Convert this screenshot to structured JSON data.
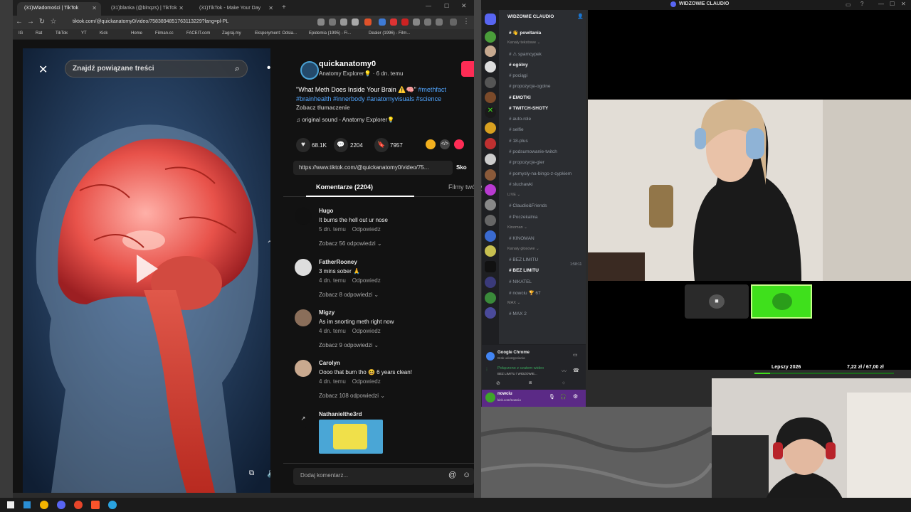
{
  "browser": {
    "tabs": [
      {
        "label": "(31)Wiadomości | TikTok",
        "active": true
      },
      {
        "label": "(31)blanka (@blnqzs) | TikTok",
        "active": false
      },
      {
        "label": "(31)TikTok - Make Your Day",
        "active": false
      }
    ],
    "url": "tiktok.com/@quickanatomy0/video/7583894851763113229?lang=pl-PL",
    "bookmarks": [
      "IG",
      "Rat",
      "TikTok",
      "YT",
      "Kick",
      "Home",
      "Filman.cc",
      "FACEIT.com",
      "Zagraj.my",
      "Eksperyment: Odsia...",
      "Epidemia (1995) - Fi...",
      "Dealer (1996) - Film..."
    ]
  },
  "video": {
    "search_placeholder": "Znajdź powiązane treści"
  },
  "post": {
    "author": "quickanatomy0",
    "subtitle": "Anatomy Explorer💡 · 6 dn. temu",
    "caption": "\"What Meth Does Inside Your Brain ⚠️🧠\" ",
    "hashtags_line1": "#methfact",
    "hashtags_line2": "#brainhealth #innerbody #anatomyvisuals #science",
    "translate": "Zobacz tłumaczenie",
    "sound": "original sound - Anatomy Explorer💡",
    "likes": "68.1K",
    "comments_count": "2204",
    "saves": "7957",
    "share_url": "https://www.tiktok.com/@quickanatomy0/video/75...",
    "copy_label": "Sko",
    "tab_comments": "Komentarze (2204)",
    "tab_creator": "Filmy twórcy",
    "add_comment_placeholder": "Dodaj komentarz..."
  },
  "comments": [
    {
      "name": "Hugo",
      "text": "It burns the hell out ur nose",
      "age": "5 dn. temu",
      "reply": "Odpowiedz",
      "more": "Zobacz 56 odpowiedzi ⌄"
    },
    {
      "name": "FatherRooney",
      "text": "3 mins sober 🙏",
      "age": "4 dn. temu",
      "reply": "Odpowiedz",
      "more": "Zobacz 8 odpowiedzi ⌄"
    },
    {
      "name": "Migzy",
      "text": "As im snorting meth right now",
      "age": "4 dn. temu",
      "reply": "Odpowiedz",
      "more": "Zobacz 9 odpowiedzi ⌄"
    },
    {
      "name": "Carolyn",
      "text": "Oooo that burn tho 😆 6 years clean!",
      "age": "4 dn. temu",
      "reply": "Odpowiedz",
      "more": "Zobacz 108 odpowiedzi ⌄"
    },
    {
      "name": "Nathanielthe3rd",
      "text": "",
      "age": "",
      "reply": "",
      "more": ""
    }
  ],
  "discord": {
    "server_name": "WIDZOWIE CLAUDIO",
    "channels": [
      {
        "label": "👋 powitania",
        "hl": true,
        "kind": "cat-item"
      },
      {
        "label": "Kanały tekstowe ⌄",
        "kind": "cat"
      },
      {
        "label": "⚠ spamcypek"
      },
      {
        "label": "ogólny",
        "hl": true
      },
      {
        "label": "pociągi"
      },
      {
        "label": "propozycje-ogolne"
      },
      {
        "label": "EMOTKI",
        "hl": true
      },
      {
        "label": "TWITCH-SHOTY",
        "hl": true
      },
      {
        "label": "auto-role"
      },
      {
        "label": "selfie"
      },
      {
        "label": "18-plus"
      },
      {
        "label": "podsumowanie-twitch"
      },
      {
        "label": "propozycje-gier"
      },
      {
        "label": "pomysly-na-bingo-z-cypkiem"
      },
      {
        "label": "sluchawki"
      },
      {
        "label": "LIVE ⌄",
        "kind": "cat"
      },
      {
        "label": "Claudio&Friends"
      },
      {
        "label": "Poczekalnia"
      },
      {
        "label": "Kinoman ⌄",
        "kind": "cat"
      },
      {
        "label": "KINOMAN"
      },
      {
        "label": "Kanały głosowe ⌄",
        "kind": "cat"
      },
      {
        "label": "BEZ LIMITU"
      },
      {
        "label": "BEZ LIMITU",
        "hl": true
      },
      {
        "label": "NIKATEL"
      },
      {
        "label": "nowciu 🏆 67"
      },
      {
        "label": "MAX ⌄",
        "kind": "cat"
      },
      {
        "label": "MAX 2"
      }
    ],
    "voice_timer": "1:58:11",
    "voice_status": "Połączono z czatem wideo",
    "voice_channel": "BEZ LIMITU / WIDZOWIE...",
    "activity": "Google Chrome",
    "activity_sub": "Brak udostępniania",
    "username": "nowciu",
    "user_sub": "kick.com/nowciu"
  },
  "stream": {
    "goal_label": "Lepszy 2026",
    "goal_value": "7,22 zł / 67,00 zł"
  },
  "window_title": "WIDZOWIE CLAUDIO"
}
